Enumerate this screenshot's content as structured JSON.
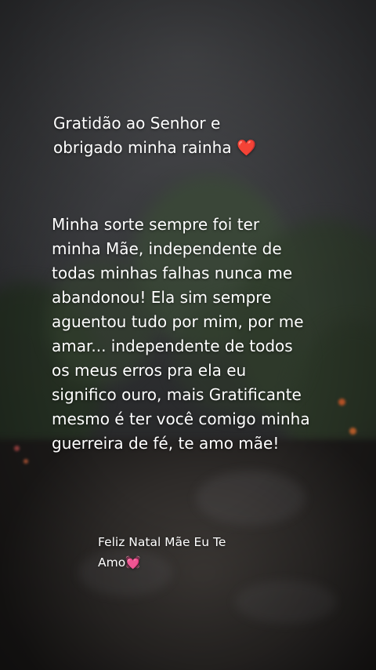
{
  "heading": {
    "text": "Gratidão ao Senhor e\nobrigado minha rainha",
    "emoji": "❤️"
  },
  "message": {
    "text": "Minha sorte sempre foi ter\nminha Mãe, independente de\ntodas minhas falhas nunca me\nabandonou! Ela sim sempre\naguentou tudo por mim, por me\namar... independente de todos\nos meus erros pra ela eu\nsignifico ouro, mais Gratificante\nmesmo é ter você comigo minha\nguerreira de fé, te amo mãe!"
  },
  "closing": {
    "text": "Feliz Natal Mãe Eu Te\nAmo",
    "emoji": "💓"
  },
  "icons": {
    "heading_emoji": "red-heart-icon",
    "closing_emoji": "beating-heart-icon"
  },
  "colors": {
    "text": "#ffffff",
    "sky": "#3a3b3e",
    "foliage": "#2f3c2b",
    "road": "#2e2b29"
  }
}
